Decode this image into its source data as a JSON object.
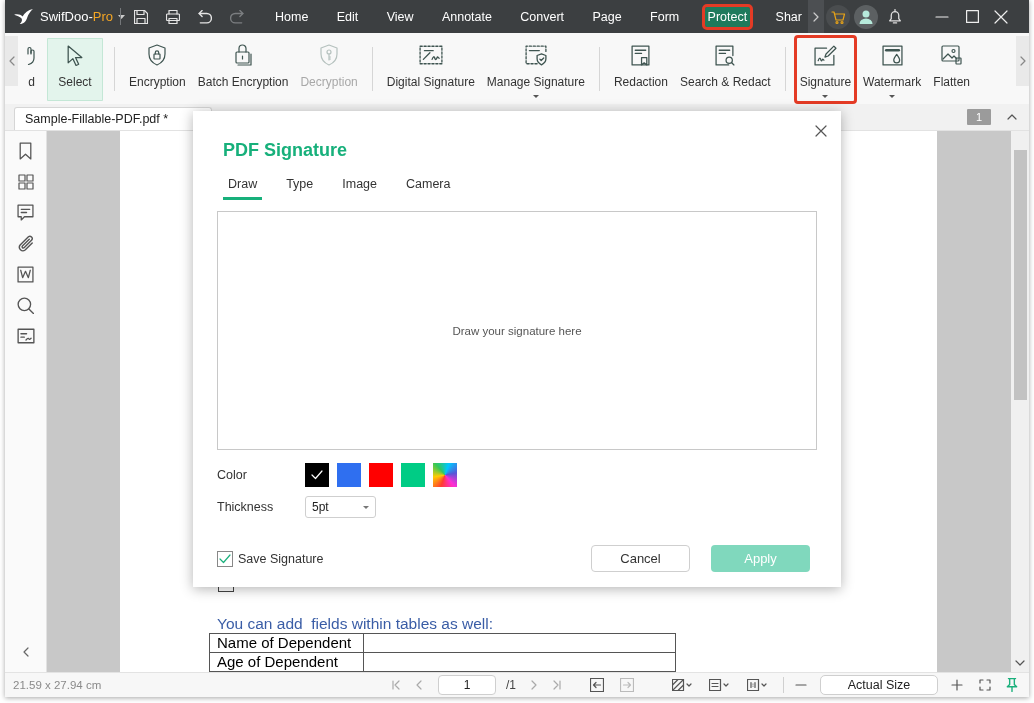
{
  "title_bar": {
    "app_name": "SwifDoo-",
    "app_edition": "Pro",
    "menus": [
      {
        "label": "Home",
        "selected": false,
        "highlighted": false
      },
      {
        "label": "Edit",
        "selected": false,
        "highlighted": false
      },
      {
        "label": "View",
        "selected": false,
        "highlighted": false
      },
      {
        "label": "Annotate",
        "selected": false,
        "highlighted": false
      },
      {
        "label": "Convert",
        "selected": false,
        "highlighted": false
      },
      {
        "label": "Page",
        "selected": false,
        "highlighted": false
      },
      {
        "label": "Form",
        "selected": false,
        "highlighted": false
      },
      {
        "label": "Protect",
        "selected": true,
        "highlighted": true
      },
      {
        "label": "Shar",
        "selected": false,
        "highlighted": false
      }
    ]
  },
  "ribbon": {
    "groups": [
      {
        "items": [
          {
            "label": "d",
            "selected": false,
            "disabled": false,
            "has_menu": false,
            "highlighted": false
          },
          {
            "label": "Select",
            "selected": true,
            "disabled": false,
            "has_menu": false,
            "highlighted": false
          }
        ]
      },
      {
        "items": [
          {
            "label": "Encryption",
            "selected": false,
            "disabled": false,
            "has_menu": false,
            "highlighted": false
          },
          {
            "label": "Batch Encryption",
            "selected": false,
            "disabled": false,
            "has_menu": false,
            "highlighted": false
          },
          {
            "label": "Decryption",
            "selected": false,
            "disabled": true,
            "has_menu": false,
            "highlighted": false
          }
        ]
      },
      {
        "items": [
          {
            "label": "Digital Signature",
            "selected": false,
            "disabled": false,
            "has_menu": false,
            "highlighted": false
          },
          {
            "label": "Manage Signature",
            "selected": false,
            "disabled": false,
            "has_menu": true,
            "highlighted": false
          }
        ]
      },
      {
        "items": [
          {
            "label": "Redaction",
            "selected": false,
            "disabled": false,
            "has_menu": false,
            "highlighted": false
          },
          {
            "label": "Search & Redact",
            "selected": false,
            "disabled": false,
            "has_menu": false,
            "highlighted": false
          }
        ]
      },
      {
        "items": [
          {
            "label": "Signature",
            "selected": false,
            "disabled": false,
            "has_menu": true,
            "highlighted": true
          },
          {
            "label": "Watermark",
            "selected": false,
            "disabled": false,
            "has_menu": true,
            "highlighted": false
          },
          {
            "label": "Flatten",
            "selected": false,
            "disabled": false,
            "has_menu": false,
            "highlighted": false
          }
        ]
      }
    ]
  },
  "document_tabs": [
    {
      "label": "Sample-Fillable-PDF.pdf *",
      "selected": true
    }
  ],
  "page_badge": "1",
  "document": {
    "checkbox": {
      "checked": false
    },
    "heading": "You can add  fields within tables as well:",
    "table": {
      "rows": [
        {
          "label": "Name of Dependent"
        },
        {
          "label": "Age of Dependent"
        }
      ]
    }
  },
  "dialog": {
    "title": "PDF Signature",
    "tabs": [
      {
        "label": "Draw",
        "selected": true
      },
      {
        "label": "Type",
        "selected": false
      },
      {
        "label": "Image",
        "selected": false
      },
      {
        "label": "Camera",
        "selected": false
      }
    ],
    "canvas_hint": "Draw your signature here",
    "color_label": "Color",
    "colors": [
      {
        "kind": "swatch",
        "color": "#000000",
        "selected": true
      },
      {
        "kind": "swatch",
        "color": "#2f6ff0",
        "selected": false
      },
      {
        "kind": "swatch",
        "color": "#ff0000",
        "selected": false
      },
      {
        "kind": "swatch",
        "color": "#00cc85",
        "selected": false
      },
      {
        "kind": "picker",
        "selected": false
      }
    ],
    "thickness_label": "Thickness",
    "thickness": "5pt",
    "save_signature": {
      "label": "Save Signature",
      "checked": true
    },
    "buttons": [
      {
        "label": "Cancel",
        "kind": "secondary",
        "disabled": false
      },
      {
        "label": "Apply",
        "kind": "primary",
        "disabled": true
      }
    ]
  },
  "status_bar": {
    "page_size": "21.59 x 27.94 cm",
    "page_input": "1",
    "page_total": "/1",
    "zoom": "Actual Size"
  }
}
